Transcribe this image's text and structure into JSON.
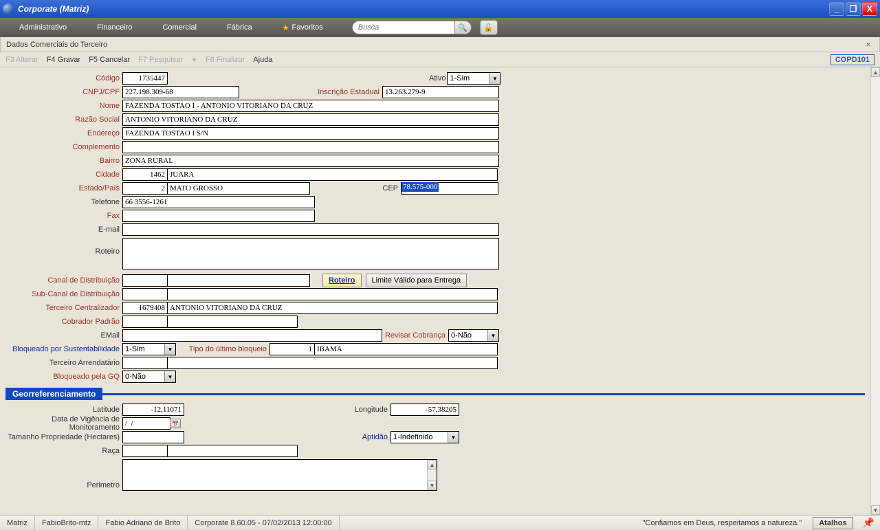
{
  "window": {
    "title": "Corporate (Matriz)"
  },
  "menu": {
    "items": [
      "Administrativo",
      "Financeiro",
      "Comercial",
      "Fábrica",
      "Favoritos"
    ],
    "search_placeholder": "Busca"
  },
  "page": {
    "title": "Dados Comerciais do Terceiro"
  },
  "toolbar": {
    "f3": "F3 Alterar",
    "f4": "F4 Gravar",
    "f5": "F5 Cancelar",
    "f7": "F7 Pesquisar",
    "f8": "F8 Finalizar",
    "ajuda": "Ajuda",
    "code": "COPD101"
  },
  "labels": {
    "codigo": "Código",
    "ativo": "Ativo",
    "cnpjcpf": "CNPJ/CPF",
    "inscest": "Inscrição Estadual",
    "nome": "Nome",
    "razao": "Razão Social",
    "endereco": "Endereço",
    "complemento": "Complemento",
    "bairro": "Bairro",
    "cidade": "Cidade",
    "estado": "Estado/País",
    "cep": "CEP",
    "telefone": "Telefone",
    "fax": "Fax",
    "email": "E-mail",
    "roteiro": "Roteiro",
    "canaldist": "Canal de Distribuição",
    "subcanal": "Sub-Canal de Distribuição",
    "tercentr": "Terceiro Centralizador",
    "cobrador": "Cobrador Padrão",
    "email2": "EMail",
    "revcobr": "Revisar Cobrança",
    "bloqsust": "Bloqueado por Sustentabilidade",
    "tipobloq": "Tipo do último bloqueio",
    "terarrend": "Terceiro Arrendatário",
    "bloqgq": "Bloqueado pela GQ",
    "georef": "Georreferenciamento",
    "latitude": "Latitude",
    "longitude": "Longitude",
    "datavig": "Data de Vigência de Monitoramento",
    "tamprop": "Tamanho Propriedade (Hectares)",
    "aptidao": "Aptidão",
    "raca": "Raça",
    "perimetro": "Perimetro"
  },
  "buttons": {
    "roteiro": "Roteiro",
    "limite": "Limite Válido para Entrega"
  },
  "values": {
    "codigo": "1735447",
    "ativo": "1-Sim",
    "cnpjcpf": "227.198.309-68",
    "inscest": "13.263.279-9",
    "nome": "FAZENDA TOSTAO I - ANTONIO VITORIANO DA CRUZ",
    "razao": "ANTONIO VITORIANO DA CRUZ",
    "endereco": "FAZENDA TOSTAO I S/N",
    "complemento": "",
    "bairro": "ZONA RURAL",
    "cidade_cod": "1462",
    "cidade_nome": "JUARA",
    "estado_cod": "2",
    "estado_nome": "MATO GROSSO",
    "cep": "78.575-000",
    "telefone": "66 3556-1261",
    "fax": "",
    "email": "",
    "roteiro": "",
    "canal_cod": "",
    "canal_nome": "",
    "subcanal_cod": "",
    "subcanal_nome": "",
    "tercentr_cod": "1679408",
    "tercentr_nome": "ANTONIO VITORIANO DA CRUZ",
    "cobrador_cod": "",
    "cobrador_nome": "",
    "email2": "",
    "revcobr": "0-Não",
    "bloqsust": "1-Sim",
    "tipobloq_cod": "1",
    "tipobloq_nome": "IBAMA",
    "terarrend_cod": "",
    "terarrend_nome": "",
    "bloqgq": "0-Não",
    "latitude": "-12,11071",
    "longitude": "-57,38205",
    "datavig": "/  /",
    "tamprop": "",
    "aptidao": "1-Indefinido",
    "raca_cod": "",
    "raca_nome": ""
  },
  "status": {
    "segs": [
      "Matriz",
      "FabioBrito-mtz",
      "Fabio Adriano de Brito",
      "Corporate 8.60.05 - 07/02/2013 12:00:00"
    ],
    "quote": "\"Confiamos em Deus, respeitamos a natureza.\"",
    "atalhos": "Atalhos"
  }
}
